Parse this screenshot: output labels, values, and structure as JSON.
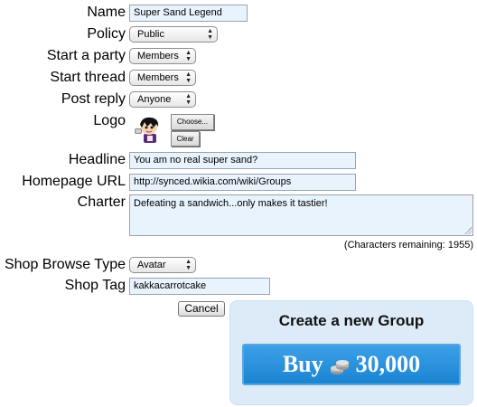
{
  "form": {
    "name": {
      "label": "Name",
      "value": "Super Sand Legend"
    },
    "policy": {
      "label": "Policy",
      "value": "Public"
    },
    "start_party": {
      "label": "Start a party",
      "value": "Members"
    },
    "start_thread": {
      "label": "Start thread",
      "value": "Members"
    },
    "post_reply": {
      "label": "Post reply",
      "value": "Anyone"
    },
    "logo": {
      "label": "Logo",
      "choose_label": "Choose...",
      "clear_label": "Clear"
    },
    "headline": {
      "label": "Headline",
      "value": "You am no real super sand?"
    },
    "homepage": {
      "label": "Homepage URL",
      "value": "http://synced.wikia.com/wiki/Groups"
    },
    "charter": {
      "label": "Charter",
      "value": "Defeating a sandwich...only makes it tastier!"
    },
    "chars_remaining": "(Characters remaining: 1955)",
    "shop_browse": {
      "label": "Shop Browse Type",
      "value": "Avatar"
    },
    "shop_tag": {
      "label": "Shop Tag",
      "value": "kakkacarrotcake"
    },
    "cancel_label": "Cancel"
  },
  "create_panel": {
    "title": "Create a new Group",
    "buy_label": "Buy",
    "price": "30,000",
    "coin_icon": "coin-stack-icon",
    "colors": {
      "panel_bg": "#dcebf7",
      "button_bg": "#1f8ad8",
      "button_text": "#ffffff"
    }
  }
}
